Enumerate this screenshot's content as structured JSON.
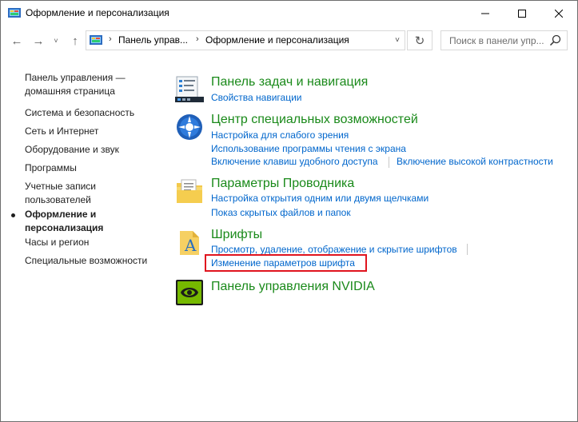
{
  "window": {
    "title": "Оформление и персонализация",
    "controls": {
      "minimize": "—",
      "maximize": "☐",
      "close": "✕"
    }
  },
  "nav": {
    "back": "←",
    "forward": "→",
    "recent": "˅",
    "up": "↑",
    "breadcrumbs": [
      "Панель управ...",
      "Оформление и персонализация"
    ],
    "separator": "›",
    "refresh": "↻",
    "search_placeholder": "Поиск в панели упр..."
  },
  "sidebar": {
    "items": [
      {
        "label": "Панель управления — домашняя страница",
        "active": false
      },
      {
        "label": "Система и безопасность",
        "active": false
      },
      {
        "label": "Сеть и Интернет",
        "active": false
      },
      {
        "label": "Оборудование и звук",
        "active": false
      },
      {
        "label": "Программы",
        "active": false
      },
      {
        "label": "Учетные записи пользователей",
        "active": false
      },
      {
        "label": "Оформление и персонализация",
        "active": true
      },
      {
        "label": "Часы и регион",
        "active": false
      },
      {
        "label": "Специальные возможности",
        "active": false
      }
    ]
  },
  "categories": [
    {
      "title": "Панель задач и навигация",
      "icon": "taskbar-icon",
      "links": [
        "Свойства навигации"
      ]
    },
    {
      "title": "Центр специальных возможностей",
      "icon": "ease-of-access-icon",
      "links": [
        "Настройка для слабого зрения",
        "Использование программы чтения с экрана",
        "Включение клавиш удобного доступа",
        "Включение высокой контрастности"
      ]
    },
    {
      "title": "Параметры Проводника",
      "icon": "folder-options-icon",
      "links": [
        "Настройка открытия одним или двумя щелчками",
        "Показ скрытых файлов и папок"
      ]
    },
    {
      "title": "Шрифты",
      "icon": "fonts-icon",
      "links": [
        "Просмотр, удаление, отображение и скрытие шрифтов",
        "Изменение параметров шрифта"
      ]
    },
    {
      "title": "Панель управления NVIDIA",
      "icon": "nvidia-icon",
      "links": []
    }
  ],
  "colors": {
    "category_title": "#1a8a1a",
    "link": "#0066cc",
    "highlight": "#e0141e"
  }
}
